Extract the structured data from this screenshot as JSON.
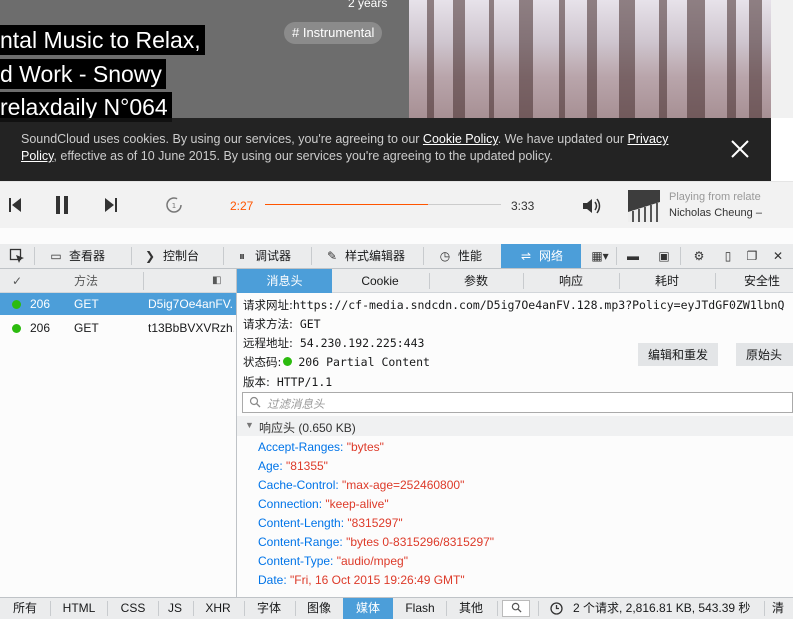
{
  "hero": {
    "title_lines": [
      "ntal Music to Relax,",
      "d Work - Snowy",
      "relaxdaily N°064"
    ],
    "date": "2 years",
    "tag": "# Instrumental"
  },
  "cookie_banner": {
    "text_1": "SoundCloud uses cookies. By using our services, you're agreeing to our ",
    "link_1": "Cookie Policy",
    "text_2": ". We have updated our ",
    "link_2": "Privacy Policy",
    "text_3": ", effective as of 10 June 2015. By using our services you're agreeing to the updated policy."
  },
  "player": {
    "current_time": "2:27",
    "total_time": "3:33",
    "progress": 0.69,
    "playing_from": "Playing from relate",
    "artist": "Nicholas Cheung –"
  },
  "devtools": {
    "tabs": [
      {
        "label": "查看器",
        "icon": "inspector-icon"
      },
      {
        "label": "控制台",
        "icon": "console-icon"
      },
      {
        "label": "调试器",
        "icon": "debugger-icon"
      },
      {
        "label": "样式编辑器",
        "icon": "style-editor-icon"
      },
      {
        "label": "性能",
        "icon": "performance-icon"
      },
      {
        "label": "网络",
        "icon": "network-icon"
      }
    ],
    "request_list": {
      "columns": [
        "✓",
        "方法"
      ],
      "rows": [
        {
          "status": "206",
          "method": "GET",
          "file": "D5ig7Oe4anFV.",
          "selected": true
        },
        {
          "status": "206",
          "method": "GET",
          "file": "t13BbBVXVRzh.",
          "selected": false
        }
      ]
    },
    "detail_tabs": [
      "消息头",
      "Cookie",
      "参数",
      "响应",
      "耗时",
      "安全性"
    ],
    "request": {
      "url_label": "请求网址:",
      "url": "https://cf-media.sndcdn.com/D5ig7Oe4anFV.128.mp3?Policy=eyJTdGF0ZW1lbnQ",
      "method_label": "请求方法:",
      "method": "GET",
      "remote_label": "远程地址:",
      "remote": "54.230.192.225:443",
      "status_label": "状态码:",
      "status": "206 Partial Content",
      "version_label": "版本:",
      "version": "HTTP/1.1"
    },
    "edit_resend": "编辑和重发",
    "raw_headers": "原始头",
    "filter_placeholder": "过滤消息头",
    "response_headers_label": "响应头 (0.650 KB)",
    "headers": [
      {
        "name": "Accept-Ranges:",
        "value": "\"bytes\""
      },
      {
        "name": "Age:",
        "value": "\"81355\""
      },
      {
        "name": "Cache-Control:",
        "value": "\"max-age=252460800\""
      },
      {
        "name": "Connection:",
        "value": "\"keep-alive\""
      },
      {
        "name": "Content-Length:",
        "value": "\"8315297\""
      },
      {
        "name": "Content-Range:",
        "value": "\"bytes 0-8315296/8315297\""
      },
      {
        "name": "Content-Type:",
        "value": "\"audio/mpeg\""
      },
      {
        "name": "Date:",
        "value": "\"Fri, 16 Oct 2015 19:26:49 GMT\""
      }
    ],
    "filter_types": [
      "所有",
      "HTML",
      "CSS",
      "JS",
      "XHR",
      "字体",
      "图像",
      "媒体",
      "Flash",
      "其他"
    ],
    "active_filter": "媒体",
    "summary": "2 个请求, 2,816.81 KB, 543.39 秒",
    "clear": "清"
  },
  "colors": {
    "accent": "#4c9ed9",
    "soundcloud_orange": "#ff5500",
    "status_green": "#2cbb0f",
    "header_name": "#0074e8",
    "header_value": "#dd3a29"
  }
}
